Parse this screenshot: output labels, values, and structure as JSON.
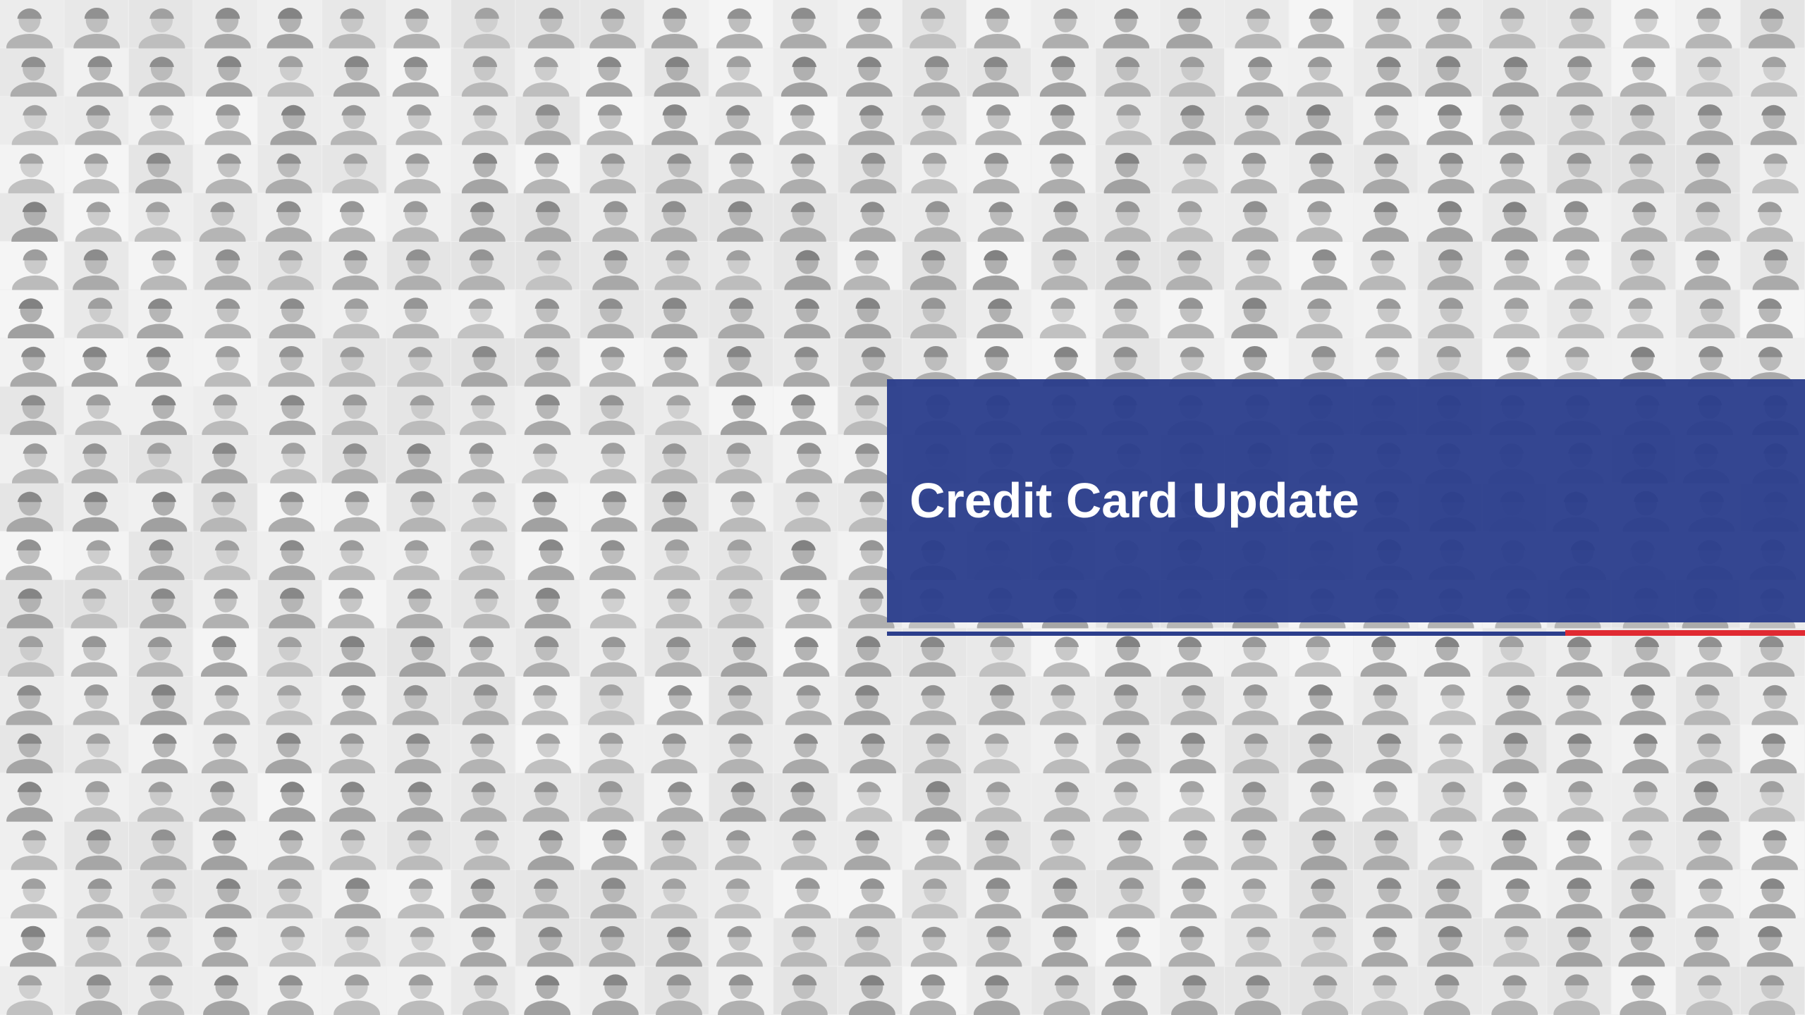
{
  "slide": {
    "title": "Credit Card Update"
  },
  "background": {
    "description_icon": "portrait-mosaic",
    "tile_color": "#d9d9d9",
    "silhouette_color": "#bcbcbc"
  },
  "colors": {
    "title_band": "#2c3e8c",
    "title_text": "#ffffff",
    "accent_line_blue": "#2c3e8c",
    "accent_line_red": "#e02a32",
    "page_background": "#f0f0f0"
  }
}
